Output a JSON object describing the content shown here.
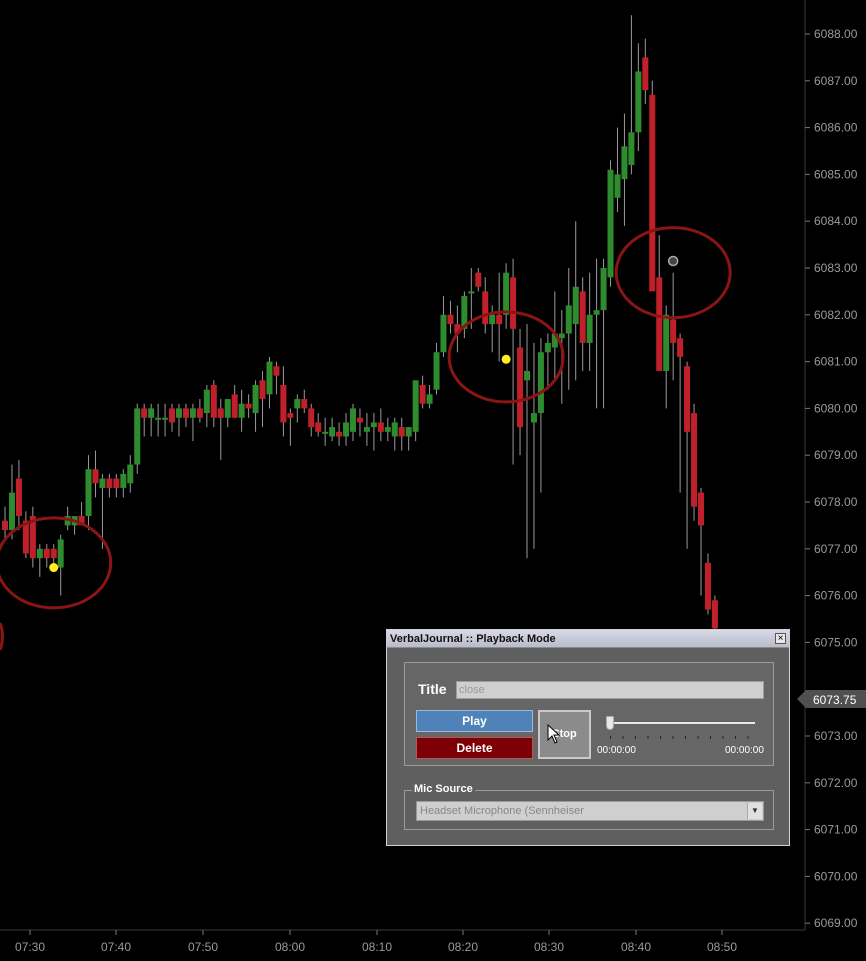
{
  "chart_data": {
    "type": "candlestick",
    "y_axis_labels": [
      "6088.00",
      "6087.00",
      "6086.00",
      "6085.00",
      "6084.00",
      "6083.00",
      "6082.00",
      "6081.00",
      "6080.00",
      "6079.00",
      "6078.00",
      "6077.00",
      "6076.00",
      "6075.00",
      "6073.00",
      "6072.00",
      "6071.00",
      "6070.00",
      "6069.00"
    ],
    "y_axis_values": [
      6088,
      6087,
      6086,
      6085,
      6084,
      6083,
      6082,
      6081,
      6080,
      6079,
      6078,
      6077,
      6076,
      6075,
      6073,
      6072,
      6071,
      6070,
      6069
    ],
    "x_axis_labels": [
      "07:30",
      "07:40",
      "07:50",
      "08:00",
      "08:10",
      "08:20",
      "08:30",
      "08:40",
      "08:50"
    ],
    "ylim": [
      6068.75,
      6088.5
    ],
    "last_price": "6073.75",
    "last_price_value": 6073.75,
    "colors": {
      "up": "#2e8b2e",
      "down": "#c0202a",
      "marker": "#ffef1a",
      "circle": "#8b1414"
    },
    "candles": [
      {
        "o": 6077.6,
        "h": 6077.9,
        "l": 6077.2,
        "c": 6077.4
      },
      {
        "o": 6077.4,
        "h": 6078.8,
        "l": 6077.2,
        "c": 6078.2
      },
      {
        "o": 6078.5,
        "h": 6078.9,
        "l": 6077.4,
        "c": 6077.7
      },
      {
        "o": 6077.6,
        "h": 6077.8,
        "l": 6076.8,
        "c": 6076.9
      },
      {
        "o": 6077.7,
        "h": 6077.9,
        "l": 6076.6,
        "c": 6076.8
      },
      {
        "o": 6076.8,
        "h": 6077.1,
        "l": 6076.4,
        "c": 6077.0
      },
      {
        "o": 6077.0,
        "h": 6077.1,
        "l": 6076.6,
        "c": 6076.8
      },
      {
        "o": 6077.0,
        "h": 6077.1,
        "l": 6076.6,
        "c": 6076.8
      },
      {
        "o": 6076.6,
        "h": 6077.3,
        "l": 6076.0,
        "c": 6077.2
      },
      {
        "o": 6077.5,
        "h": 6077.9,
        "l": 6077.4,
        "c": 6077.7
      },
      {
        "o": 6077.5,
        "h": 6077.7,
        "l": 6077.3,
        "c": 6077.7
      },
      {
        "o": 6077.7,
        "h": 6078.0,
        "l": 6077.5,
        "c": 6077.5
      },
      {
        "o": 6077.7,
        "h": 6079.0,
        "l": 6077.4,
        "c": 6078.7
      },
      {
        "o": 6078.7,
        "h": 6079.1,
        "l": 6078.1,
        "c": 6078.4
      },
      {
        "o": 6078.3,
        "h": 6078.6,
        "l": 6077.0,
        "c": 6078.5
      },
      {
        "o": 6078.5,
        "h": 6078.6,
        "l": 6078.1,
        "c": 6078.3
      },
      {
        "o": 6078.5,
        "h": 6078.6,
        "l": 6078.1,
        "c": 6078.3
      },
      {
        "o": 6078.3,
        "h": 6078.7,
        "l": 6078.1,
        "c": 6078.6
      },
      {
        "o": 6078.4,
        "h": 6079.0,
        "l": 6078.2,
        "c": 6078.8
      },
      {
        "o": 6078.8,
        "h": 6080.1,
        "l": 6078.6,
        "c": 6080.0
      },
      {
        "o": 6080.0,
        "h": 6080.1,
        "l": 6079.4,
        "c": 6079.8
      },
      {
        "o": 6079.8,
        "h": 6080.1,
        "l": 6079.4,
        "c": 6080.0
      },
      {
        "o": 6079.8,
        "h": 6080.1,
        "l": 6079.4,
        "c": 6079.8
      },
      {
        "o": 6079.8,
        "h": 6080.1,
        "l": 6079.4,
        "c": 6079.8
      },
      {
        "o": 6080.0,
        "h": 6080.1,
        "l": 6079.5,
        "c": 6079.7
      },
      {
        "o": 6079.8,
        "h": 6080.1,
        "l": 6079.4,
        "c": 6080.0
      },
      {
        "o": 6080.0,
        "h": 6080.1,
        "l": 6079.6,
        "c": 6079.8
      },
      {
        "o": 6079.8,
        "h": 6080.1,
        "l": 6079.3,
        "c": 6080.0
      },
      {
        "o": 6080.0,
        "h": 6080.2,
        "l": 6079.7,
        "c": 6079.8
      },
      {
        "o": 6079.9,
        "h": 6080.5,
        "l": 6079.6,
        "c": 6080.4
      },
      {
        "o": 6080.5,
        "h": 6080.6,
        "l": 6079.6,
        "c": 6079.8
      },
      {
        "o": 6080.0,
        "h": 6080.2,
        "l": 6078.9,
        "c": 6079.8
      },
      {
        "o": 6079.8,
        "h": 6080.2,
        "l": 6079.6,
        "c": 6080.2
      },
      {
        "o": 6080.3,
        "h": 6080.5,
        "l": 6079.8,
        "c": 6079.8
      },
      {
        "o": 6079.8,
        "h": 6080.4,
        "l": 6079.5,
        "c": 6080.1
      },
      {
        "o": 6080.1,
        "h": 6080.3,
        "l": 6079.8,
        "c": 6080.0
      },
      {
        "o": 6079.9,
        "h": 6080.6,
        "l": 6079.5,
        "c": 6080.5
      },
      {
        "o": 6080.6,
        "h": 6080.8,
        "l": 6079.6,
        "c": 6080.2
      },
      {
        "o": 6080.3,
        "h": 6081.1,
        "l": 6080.0,
        "c": 6081.0
      },
      {
        "o": 6080.9,
        "h": 6081.0,
        "l": 6080.3,
        "c": 6080.7
      },
      {
        "o": 6080.5,
        "h": 6080.9,
        "l": 6079.4,
        "c": 6079.7
      },
      {
        "o": 6079.9,
        "h": 6080.0,
        "l": 6079.2,
        "c": 6079.8
      },
      {
        "o": 6080.0,
        "h": 6080.3,
        "l": 6079.7,
        "c": 6080.2
      },
      {
        "o": 6080.2,
        "h": 6080.4,
        "l": 6079.9,
        "c": 6080.0
      },
      {
        "o": 6080.0,
        "h": 6080.1,
        "l": 6079.4,
        "c": 6079.6
      },
      {
        "o": 6079.7,
        "h": 6079.9,
        "l": 6079.4,
        "c": 6079.5
      },
      {
        "o": 6079.5,
        "h": 6079.8,
        "l": 6079.2,
        "c": 6079.5
      },
      {
        "o": 6079.4,
        "h": 6079.8,
        "l": 6079.3,
        "c": 6079.6
      },
      {
        "o": 6079.5,
        "h": 6079.7,
        "l": 6079.2,
        "c": 6079.4
      },
      {
        "o": 6079.4,
        "h": 6079.9,
        "l": 6079.2,
        "c": 6079.7
      },
      {
        "o": 6079.5,
        "h": 6080.1,
        "l": 6079.3,
        "c": 6080.0
      },
      {
        "o": 6079.8,
        "h": 6080.0,
        "l": 6079.4,
        "c": 6079.7
      },
      {
        "o": 6079.5,
        "h": 6079.9,
        "l": 6079.2,
        "c": 6079.6
      },
      {
        "o": 6079.6,
        "h": 6079.9,
        "l": 6079.1,
        "c": 6079.7
      },
      {
        "o": 6079.7,
        "h": 6080.0,
        "l": 6079.3,
        "c": 6079.5
      },
      {
        "o": 6079.5,
        "h": 6079.8,
        "l": 6079.3,
        "c": 6079.6
      },
      {
        "o": 6079.4,
        "h": 6079.8,
        "l": 6079.1,
        "c": 6079.7
      },
      {
        "o": 6079.6,
        "h": 6079.8,
        "l": 6079.1,
        "c": 6079.4
      },
      {
        "o": 6079.4,
        "h": 6079.6,
        "l": 6079.1,
        "c": 6079.6
      },
      {
        "o": 6079.5,
        "h": 6080.6,
        "l": 6079.3,
        "c": 6080.6
      },
      {
        "o": 6080.5,
        "h": 6080.7,
        "l": 6080.0,
        "c": 6080.1
      },
      {
        "o": 6080.1,
        "h": 6080.5,
        "l": 6080.0,
        "c": 6080.3
      },
      {
        "o": 6080.4,
        "h": 6081.4,
        "l": 6080.3,
        "c": 6081.2
      },
      {
        "o": 6081.2,
        "h": 6082.4,
        "l": 6081.1,
        "c": 6082.0
      },
      {
        "o": 6082.0,
        "h": 6082.3,
        "l": 6081.6,
        "c": 6081.8
      },
      {
        "o": 6081.8,
        "h": 6082.2,
        "l": 6081.2,
        "c": 6081.6
      },
      {
        "o": 6081.7,
        "h": 6082.5,
        "l": 6081.5,
        "c": 6082.4
      },
      {
        "o": 6082.5,
        "h": 6083.0,
        "l": 6081.7,
        "c": 6082.5
      },
      {
        "o": 6082.9,
        "h": 6083.0,
        "l": 6082.5,
        "c": 6082.6
      },
      {
        "o": 6082.5,
        "h": 6082.8,
        "l": 6081.6,
        "c": 6081.8
      },
      {
        "o": 6081.8,
        "h": 6082.2,
        "l": 6081.2,
        "c": 6082.0
      },
      {
        "o": 6082.0,
        "h": 6082.9,
        "l": 6081.0,
        "c": 6081.8
      },
      {
        "o": 6082.0,
        "h": 6083.1,
        "l": 6081.7,
        "c": 6082.9
      },
      {
        "o": 6082.8,
        "h": 6083.2,
        "l": 6078.8,
        "c": 6081.7
      },
      {
        "o": 6081.3,
        "h": 6081.7,
        "l": 6079.0,
        "c": 6079.6
      },
      {
        "o": 6080.6,
        "h": 6081.8,
        "l": 6076.8,
        "c": 6080.8
      },
      {
        "o": 6079.7,
        "h": 6081.4,
        "l": 6077.0,
        "c": 6079.9
      },
      {
        "o": 6079.9,
        "h": 6081.5,
        "l": 6078.2,
        "c": 6081.2
      },
      {
        "o": 6081.2,
        "h": 6081.6,
        "l": 6080.4,
        "c": 6081.4
      },
      {
        "o": 6081.3,
        "h": 6082.5,
        "l": 6080.6,
        "c": 6081.6
      },
      {
        "o": 6081.5,
        "h": 6082.1,
        "l": 6080.1,
        "c": 6081.6
      },
      {
        "o": 6081.6,
        "h": 6083.0,
        "l": 6080.4,
        "c": 6082.2
      },
      {
        "o": 6081.8,
        "h": 6084.0,
        "l": 6080.6,
        "c": 6082.6
      },
      {
        "o": 6082.5,
        "h": 6082.8,
        "l": 6080.8,
        "c": 6081.4
      },
      {
        "o": 6081.4,
        "h": 6082.9,
        "l": 6080.8,
        "c": 6082.0
      },
      {
        "o": 6082.0,
        "h": 6083.2,
        "l": 6080.0,
        "c": 6082.1
      },
      {
        "o": 6082.1,
        "h": 6083.2,
        "l": 6080.0,
        "c": 6083.0
      },
      {
        "o": 6082.8,
        "h": 6085.3,
        "l": 6082.6,
        "c": 6085.1
      },
      {
        "o": 6084.5,
        "h": 6086.0,
        "l": 6084.2,
        "c": 6085.0
      },
      {
        "o": 6084.9,
        "h": 6086.3,
        "l": 6083.9,
        "c": 6085.6
      },
      {
        "o": 6085.2,
        "h": 6088.4,
        "l": 6085.0,
        "c": 6085.9
      },
      {
        "o": 6085.9,
        "h": 6087.8,
        "l": 6085.5,
        "c": 6087.2
      },
      {
        "o": 6087.5,
        "h": 6087.9,
        "l": 6086.5,
        "c": 6086.8
      },
      {
        "o": 6086.7,
        "h": 6087.0,
        "l": 6083.0,
        "c": 6082.5
      },
      {
        "o": 6082.8,
        "h": 6083.7,
        "l": 6081.5,
        "c": 6080.8
      },
      {
        "o": 6080.8,
        "h": 6082.2,
        "l": 6080.0,
        "c": 6082.0
      },
      {
        "o": 6081.9,
        "h": 6082.9,
        "l": 6080.6,
        "c": 6081.4
      },
      {
        "o": 6081.5,
        "h": 6081.6,
        "l": 6078.2,
        "c": 6081.1
      },
      {
        "o": 6080.9,
        "h": 6081.0,
        "l": 6077.0,
        "c": 6079.5
      },
      {
        "o": 6079.9,
        "h": 6080.1,
        "l": 6077.6,
        "c": 6077.9
      },
      {
        "o": 6078.2,
        "h": 6078.3,
        "l": 6076.0,
        "c": 6077.5
      },
      {
        "o": 6076.7,
        "h": 6076.9,
        "l": 6075.6,
        "c": 6075.7
      },
      {
        "o": 6075.9,
        "h": 6076.0,
        "l": 6075.1,
        "c": 6075.3
      }
    ],
    "candle_x_start": 5,
    "candle_x_step": 6.96,
    "annotations": [
      {
        "type": "circle",
        "x_index": 7,
        "y": 6076.7
      },
      {
        "type": "circle",
        "x_index": 72,
        "y": 6081.1
      },
      {
        "type": "circle",
        "x_index": 96,
        "y": 6082.9
      }
    ],
    "markers": [
      {
        "x_index": 7,
        "y": 6076.6,
        "color": "#ffef1a"
      },
      {
        "x_index": 72,
        "y": 6081.05,
        "color": "#ffef1a"
      },
      {
        "x_index": 96,
        "y": 6083.15,
        "color": "#444444"
      }
    ],
    "grid": false
  },
  "dialog": {
    "title": "VerbalJournal :: Playback Mode",
    "close_glyph": "×",
    "title_label": "Title",
    "title_value": "close",
    "play_label": "Play",
    "delete_label": "Delete",
    "stop_label": "Stop",
    "time_start": "00:00:00",
    "time_end": "00:00:00",
    "slider_position": 0,
    "mic_source_label": "Mic Source",
    "mic_source_value": "Headset Microphone (Sennheiser",
    "mic_arrow_glyph": "▼"
  }
}
